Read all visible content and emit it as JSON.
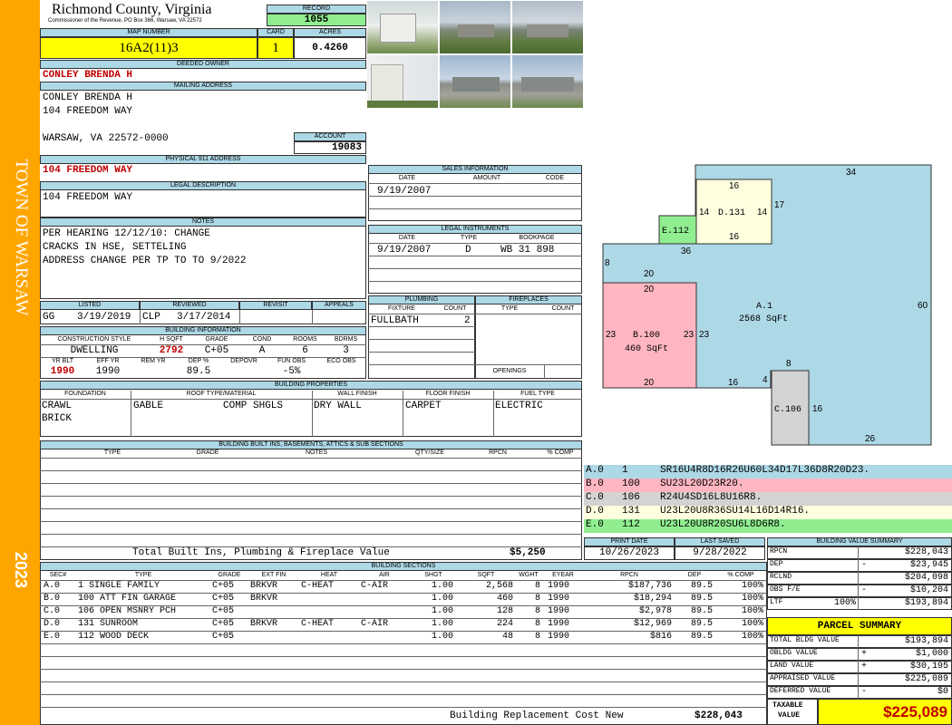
{
  "banner": {
    "town": "TOWN OF WARSAW",
    "year": "2023"
  },
  "header": {
    "county": "Richmond County, Virginia",
    "commissioner": "Commissioner of the Revenue, PO Box 366, Warsaw, VA 22572",
    "record_label": "RECORD",
    "record": "1055",
    "map_label": "MAP NUMBER",
    "map_number": "16A2(11)3",
    "card_label": "CARD",
    "card": "1",
    "acres_label": "ACRES",
    "acres": "0.4260"
  },
  "owner": {
    "deeded_label": "DEEDED OWNER",
    "deeded_owner": "CONLEY BRENDA H",
    "mailing_label": "MAILING ADDRESS",
    "mail1": "CONLEY BRENDA H",
    "mail2": "104 FREEDOM WAY",
    "mail3": "WARSAW, VA 22572-0000",
    "account_label": "ACCOUNT",
    "account": "19083",
    "phys_label": "PHYSICAL 911 ADDRESS",
    "physical": "104 FREEDOM WAY",
    "legal_label": "LEGAL DESCRIPTION",
    "legal": "104 FREEDOM WAY"
  },
  "notes": {
    "label": "NOTES",
    "line1": "PER HEARING 12/12/10: CHANGE",
    "line2": "CRACKS IN HSE, SETTELING",
    "line3": "ADDRESS CHANGE PER TP TO TO 9/2022"
  },
  "sales": {
    "label": "SALES INFORMATION",
    "col_date": "DATE",
    "col_amount": "AMOUNT",
    "col_code": "CODE",
    "date": "9/19/2007"
  },
  "legal_instr": {
    "label": "LEGAL INSTRUMENTS",
    "col_date": "DATE",
    "col_type": "TYPE",
    "col_book": "BOOKPAGE",
    "date": "9/19/2007",
    "type": "D",
    "book": "WB 31 898"
  },
  "plumbing": {
    "label": "PLUMBING",
    "col_fixture": "FIXTURE",
    "col_count": "COUNT",
    "fixture": "FULLBATH",
    "count": "2"
  },
  "fireplaces": {
    "label": "FIREPLACES",
    "col_type": "TYPE",
    "col_count": "COUNT",
    "openings": "OPENINGS"
  },
  "listing": {
    "listed_label": "LISTED",
    "reviewed_label": "REVIEWED",
    "revisit_label": "REVISIT",
    "appeals_label": "APPEALS",
    "listed_by": "GG",
    "listed_date": "3/19/2019",
    "reviewed_by": "CLP",
    "reviewed_date": "3/17/2014"
  },
  "building_info": {
    "label": "BUILDING INFORMATION",
    "h_cs": "CONSTRUCTION STYLE",
    "h_hsqft": "H SQFT",
    "h_grade": "GRADE",
    "h_cond": "COND",
    "h_rooms": "ROOMS",
    "h_bdrms": "BDRMS",
    "cs": "DWELLING",
    "hsqft": "2792",
    "grade": "C+05",
    "cond": "A",
    "rooms": "6",
    "bdrms": "3",
    "h_yrblt": "YR BLT",
    "h_effyr": "EFF YR",
    "h_remyr": "REM YR",
    "h_dep": "DEP %",
    "h_depovr": "DEPOVR",
    "h_funobs": "FUN OBS",
    "h_ecoobs": "ECO OBS",
    "yrblt": "1990",
    "effyr": "1990",
    "dep": "89.5",
    "funobs": "-5%"
  },
  "properties": {
    "label": "BUILDING PROPERTIES",
    "h_found": "FOUNDATION",
    "h_roof": "ROOF TYPE/MATERIAL",
    "h_wall": "WALL FINISH",
    "h_floor": "FLOOR FINISH",
    "h_fuel": "FUEL TYPE",
    "found1": "CRAWL",
    "found2": "BRICK",
    "roof_type": "GABLE",
    "roof_mat": "COMP SHGLS",
    "wall": "DRY WALL",
    "floor": "CARPET",
    "fuel": "ELECTRIC"
  },
  "builtins": {
    "label": "BUILDING BUILT INS, BASEMENTS, ATTICS & SUB SECTIONS",
    "h_type": "TYPE",
    "h_grade": "GRADE",
    "h_notes": "NOTES",
    "h_qty": "QTY/SIZE",
    "h_rpcn": "RPCN",
    "h_comp": "% COMP",
    "total_label": "Total Built Ins, Plumbing & Fireplace Value",
    "total": "$5,250"
  },
  "sketch_legend": [
    {
      "code": "A.0",
      "num": "1",
      "desc": "SR16U4R8D16R26U60L34D17L36D8R20D23.",
      "color": "#add8e6"
    },
    {
      "code": "B.0",
      "num": "100",
      "desc": "SU23L20D23R20.",
      "color": "#ffb6c1"
    },
    {
      "code": "C.0",
      "num": "106",
      "desc": "R24U4SD16L8U16R8.",
      "color": "#d3d3d3"
    },
    {
      "code": "D.0",
      "num": "131",
      "desc": "U23L20U8R36SU14L16D14R16.",
      "color": "#ffffe0"
    },
    {
      "code": "E.0",
      "num": "112",
      "desc": "U23L20U8R20SU6L8D6R8.",
      "color": "#90ee90"
    }
  ],
  "sketch": {
    "a_label": "A.1",
    "a_area": "2568 SqFt",
    "b_label": "B.100",
    "b_area": "460 SqFt",
    "c_label": "C.106",
    "d_label": "D.131",
    "e_label": "E.112",
    "dims": [
      "34",
      "60",
      "26",
      "16",
      "4",
      "8",
      "16",
      "20",
      "23",
      "23",
      "20",
      "23",
      "20",
      "8",
      "36",
      "16",
      "17",
      "14",
      "14",
      "16"
    ]
  },
  "dates": {
    "print_label": "PRINT DATE",
    "saved_label": "LAST SAVED",
    "print": "10/26/2023",
    "saved": "9/28/2022"
  },
  "value_summary": {
    "label": "BUILDING VALUE SUMMARY",
    "rows": [
      {
        "k": "RPCN",
        "s": "",
        "p": "",
        "v": "$228,043"
      },
      {
        "k": "DEP",
        "s": "-",
        "p": "",
        "v": "$23,945"
      },
      {
        "k": "RCLND",
        "s": "",
        "p": "",
        "v": "$204,098"
      },
      {
        "k": "OBS F/E",
        "s": "-",
        "p": "",
        "v": "$10,204"
      },
      {
        "k": "LTF",
        "s": "",
        "p": "100%",
        "v": "$193,894"
      }
    ]
  },
  "parcel": {
    "label": "PARCEL SUMMARY",
    "rows": [
      {
        "k": "TOTAL BLDG VALUE",
        "s": "",
        "v": "$193,894"
      },
      {
        "k": "OBLDG VALUE",
        "s": "+",
        "v": "$1,000"
      },
      {
        "k": "LAND VALUE",
        "s": "+",
        "v": "$30,195"
      },
      {
        "k": "APPRAISED VALUE",
        "s": "",
        "v": "$225,089"
      },
      {
        "k": "DEFERRED VALUE",
        "s": "-",
        "v": "$0"
      }
    ],
    "taxable_label1": "TAXABLE",
    "taxable_label2": "VALUE",
    "taxable": "$225,089"
  },
  "sections": {
    "label": "BUILDING SECTIONS",
    "headers": [
      "SEC#",
      "TYPE",
      "GRADE",
      "EXT FIN",
      "HEAT",
      "AIR",
      "SHGT",
      "SQFT",
      "WGHT",
      "EYEAR",
      "RPCN",
      "DEP",
      "% COMP"
    ],
    "rows": [
      [
        "A.0",
        "1 SINGLE FAMILY",
        "C+05",
        "BRKVR",
        "C-HEAT",
        "C-AIR",
        "1.00",
        "2,568",
        "8",
        "1990",
        "$187,736",
        "89.5",
        "100%"
      ],
      [
        "B.0",
        "100 ATT FIN GARAGE",
        "C+05",
        "BRKVR",
        "",
        "",
        "1.00",
        "460",
        "8",
        "1990",
        "$18,294",
        "89.5",
        "100%"
      ],
      [
        "C.0",
        "106 OPEN MSNRY PCH",
        "C+05",
        "",
        "",
        "",
        "1.00",
        "128",
        "8",
        "1990",
        "$2,978",
        "89.5",
        "100%"
      ],
      [
        "D.0",
        "131 SUNROOM",
        "C+05",
        "BRKVR",
        "C-HEAT",
        "C-AIR",
        "1.00",
        "224",
        "8",
        "1990",
        "$12,969",
        "89.5",
        "100%"
      ],
      [
        "E.0",
        "112 WOOD DECK",
        "C+05",
        "",
        "",
        "",
        "1.00",
        "48",
        "8",
        "1990",
        "$816",
        "89.5",
        "100%"
      ]
    ],
    "total_label": "Building Replacement Cost New",
    "total": "$228,043"
  }
}
